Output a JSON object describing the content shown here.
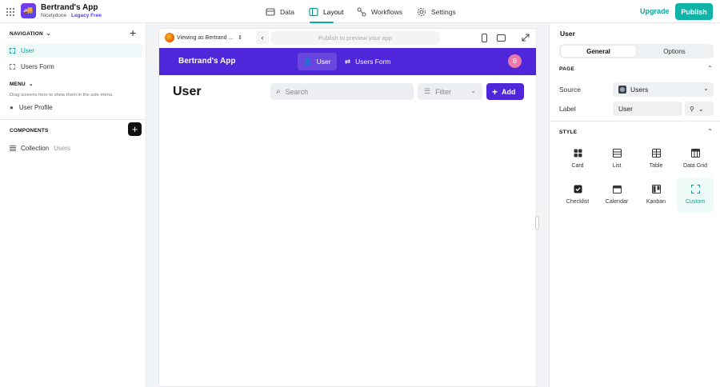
{
  "topbar": {
    "app_name": "Bertrand's App",
    "workspace": "Nicelydone",
    "separator": "·",
    "plan": "Legacy Free",
    "nav": [
      {
        "label": "Data",
        "icon": "database-icon"
      },
      {
        "label": "Layout",
        "icon": "layout-icon",
        "active": true
      },
      {
        "label": "Workflows",
        "icon": "workflow-icon"
      },
      {
        "label": "Settings",
        "icon": "gear-icon"
      }
    ],
    "upgrade_label": "Upgrade",
    "publish_label": "Publish"
  },
  "left_panel": {
    "navigation_label": "NAVIGATION",
    "screens": [
      {
        "label": "User",
        "active": true
      },
      {
        "label": "Users Form",
        "active": false
      }
    ],
    "menu_label": "MENU",
    "menu_hint": "Drag screens here to show them in the side menu.",
    "menu_items": [
      {
        "label": "User Profile"
      }
    ],
    "components_label": "COMPONENTS",
    "components": [
      {
        "type": "Collection",
        "source": "Users"
      }
    ]
  },
  "preview": {
    "viewing_as": "Viewing as Bertrand ...",
    "publish_placeholder": "Publish to preview your app",
    "app_name": "Bertrand's App",
    "tabs": [
      {
        "label": "User",
        "active": true
      },
      {
        "label": "Users Form",
        "active": false
      }
    ],
    "avatar_initial": "B",
    "page_title": "User",
    "search_placeholder": "Search",
    "filter_label": "Filter",
    "add_label": "Add"
  },
  "right_panel": {
    "title": "User",
    "segments": [
      {
        "label": "General",
        "active": true
      },
      {
        "label": "Options",
        "active": false
      }
    ],
    "page_section": "PAGE",
    "source_label": "Source",
    "source_value": "Users",
    "label_label": "Label",
    "label_value": "User",
    "style_section": "STYLE",
    "styles": [
      {
        "label": "Card",
        "icon": "card-icon",
        "active": false
      },
      {
        "label": "List",
        "icon": "list-icon",
        "active": false
      },
      {
        "label": "Table",
        "icon": "table-icon",
        "active": false
      },
      {
        "label": "Data Grid",
        "icon": "data-grid-icon",
        "active": false
      },
      {
        "label": "Checklist",
        "icon": "checklist-icon",
        "active": false
      },
      {
        "label": "Calendar",
        "icon": "calendar-icon",
        "active": false
      },
      {
        "label": "Kanban",
        "icon": "kanban-icon",
        "active": false
      },
      {
        "label": "Custom",
        "icon": "custom-icon",
        "active": true
      }
    ]
  },
  "colors": {
    "accent": "#11b3a6",
    "preview_brand": "#4f26d9",
    "avatar": "#e879a8"
  }
}
